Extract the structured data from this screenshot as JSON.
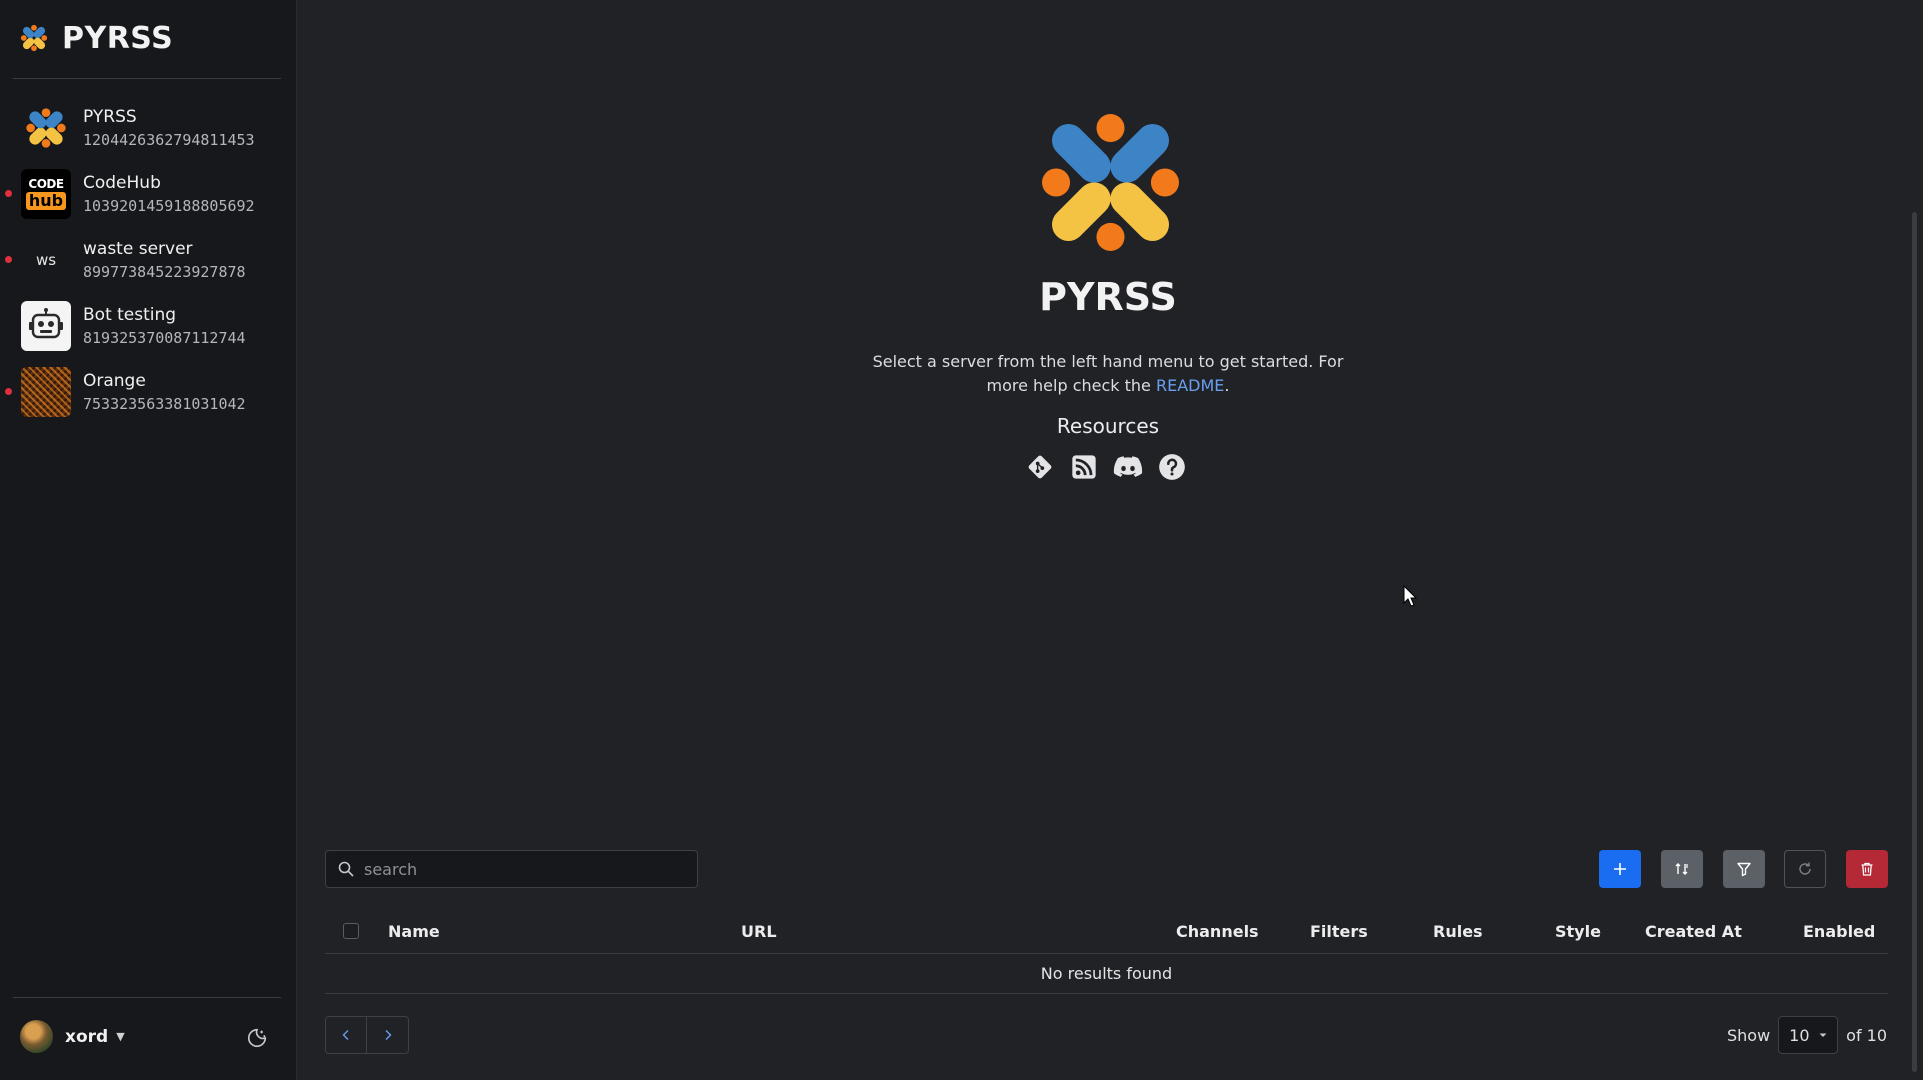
{
  "app": {
    "brand": "PYRSS"
  },
  "servers": [
    {
      "name": "PYRSS",
      "id": "1204426362794811453",
      "unread": false,
      "thumb": "pyrss-logo"
    },
    {
      "name": "CodeHub",
      "id": "1039201459188805692",
      "unread": true,
      "thumb": "codehub-logo",
      "thumb_text_top": "CODE",
      "thumb_text_bottom": "hub"
    },
    {
      "name": "waste server",
      "id": "899773845223927878",
      "unread": true,
      "thumb": "initials",
      "thumb_text": "ws"
    },
    {
      "name": "Bot testing",
      "id": "819325370087112744",
      "unread": false,
      "thumb": "robot-icon"
    },
    {
      "name": "Orange",
      "id": "753323563381031042",
      "unread": true,
      "thumb": "orange-texture"
    }
  ],
  "user": {
    "name": "xord"
  },
  "hero": {
    "title": "PYRSS",
    "text_before": "Select a server from the left hand menu to get started. For more help check the ",
    "link": "README",
    "text_after": ".",
    "resources_title": "Resources"
  },
  "search": {
    "placeholder": "search",
    "value": ""
  },
  "table": {
    "columns": [
      "Name",
      "URL",
      "Channels",
      "Filters",
      "Rules",
      "Style",
      "Created At",
      "Enabled"
    ],
    "empty_message": "No results found"
  },
  "pagination": {
    "show_label": "Show",
    "page_size": "10",
    "of_label": "of 10"
  },
  "colors": {
    "accent": "#1a6cf0",
    "danger": "#b52835",
    "link": "#6a9ff0",
    "unread": "#e0303e"
  }
}
